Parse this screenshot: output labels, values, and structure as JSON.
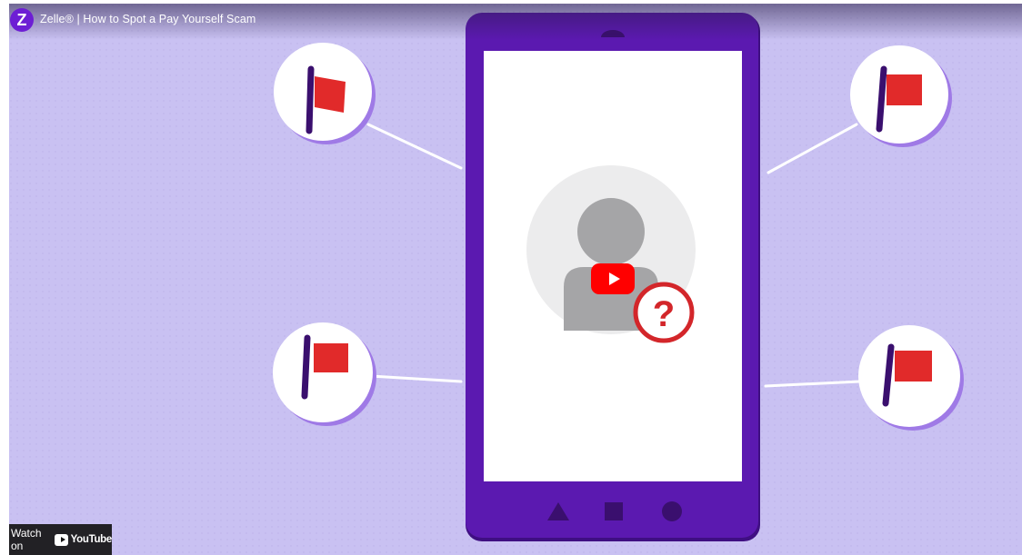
{
  "video": {
    "title": "Zelle® | How to Spot a Pay Yourself Scam",
    "channel_logo_letter": "Z",
    "play_icon": "play-icon",
    "watch_on_label": "Watch on",
    "youtube_wordmark": "YouTube"
  },
  "colors": {
    "background": "#c9c1f2",
    "phone": "#5b19b0",
    "phone_dark": "#3f0f82",
    "flag": "#e12a2a",
    "pole": "#3a0f6e",
    "badge_red": "#d3262a",
    "avatar_gray": "#a5a5a7",
    "play_red": "#ff0000"
  },
  "scene": {
    "flag_count": 4,
    "phone_nav_icons": [
      "triangle-icon",
      "square-icon",
      "circle-icon"
    ],
    "badge_symbol": "?"
  }
}
